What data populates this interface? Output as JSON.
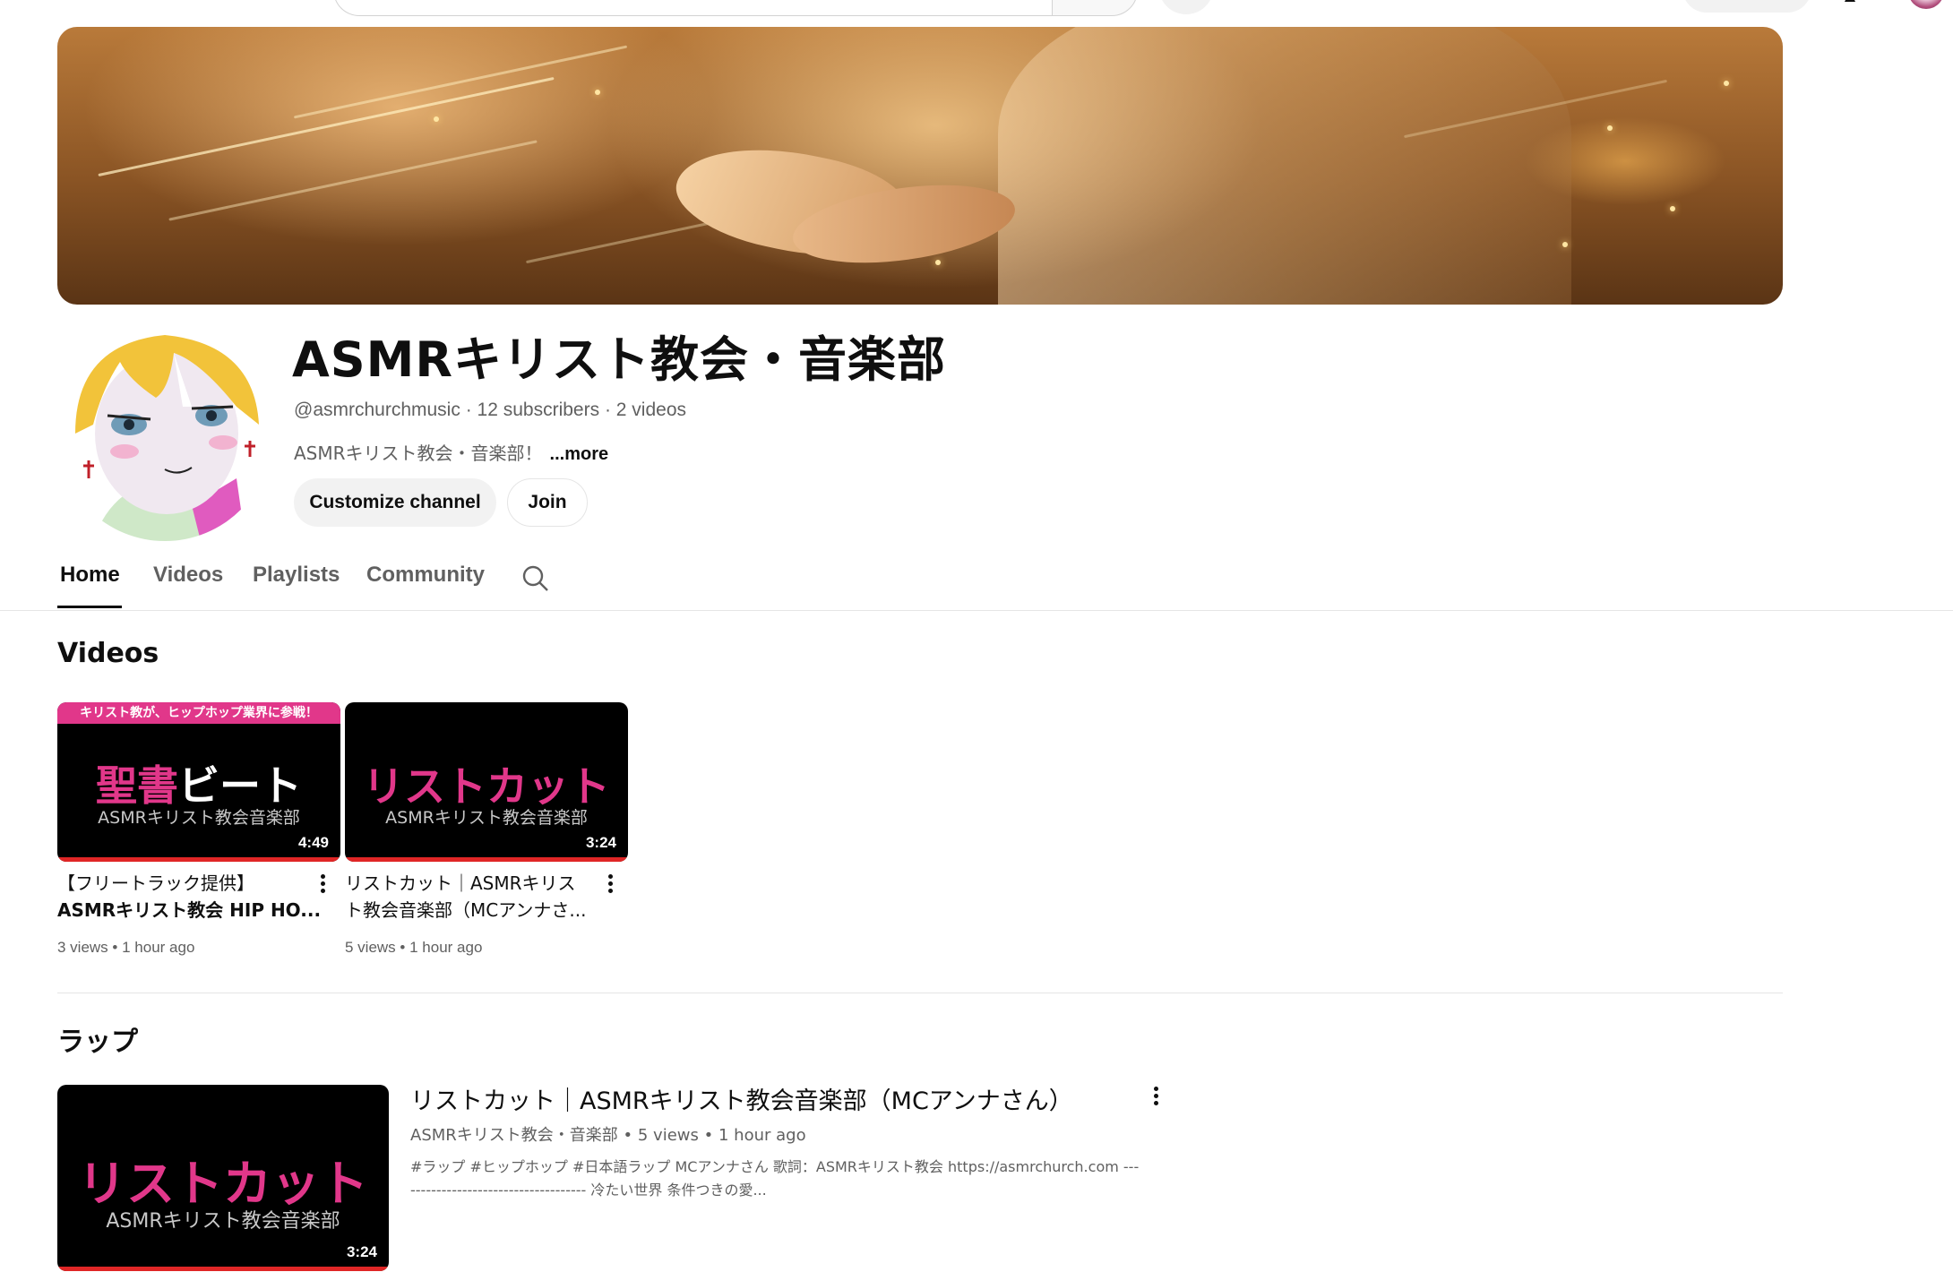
{
  "channel": {
    "name": "ASMRキリスト教会・音楽部",
    "handle": "@asmrchurchmusic",
    "subscribers": "12 subscribers",
    "video_count": "2 videos",
    "description": "ASMRキリスト教会・音楽部！",
    "more_label": "...more",
    "customize_label": "Customize channel",
    "join_label": "Join"
  },
  "tabs": [
    {
      "label": "Home",
      "active": true
    },
    {
      "label": "Videos",
      "active": false
    },
    {
      "label": "Playlists",
      "active": false
    },
    {
      "label": "Community",
      "active": false
    }
  ],
  "sections": {
    "videos": {
      "title": "Videos",
      "items": [
        {
          "thumb_strip": "キリスト教が、ヒップホップ業界に参戦！",
          "thumb_big_pink": "聖書",
          "thumb_big_white": "ビート",
          "thumb_sub": "ASMRキリスト教会音楽部",
          "duration": "4:49",
          "title_line1": "【フリートラック提供】",
          "title_line2": "ASMRキリスト教会 HIP HO...",
          "views": "3 views",
          "age": "1 hour ago"
        },
        {
          "thumb_big_pink": "リストカット",
          "thumb_sub": "ASMRキリスト教会音楽部",
          "duration": "3:24",
          "title_line1": "リストカット｜ASMRキリス",
          "title_line2": "ト教会音楽部（MCアンナさ...",
          "views": "5 views",
          "age": "1 hour ago"
        }
      ]
    },
    "rap": {
      "title": "ラップ",
      "featured": {
        "thumb_big_pink": "リストカット",
        "thumb_sub": "ASMRキリスト教会音楽部",
        "duration": "3:24",
        "title": "リストカット｜ASMRキリスト教会音楽部（MCアンナさん）",
        "channel": "ASMRキリスト教会・音楽部",
        "views": "5 views",
        "age": "1 hour ago",
        "desc_line1": "#ラップ #ヒップホップ #日本語ラップ MCアンナさん 歌詞：ASMRキリスト教会 https://asmrchurch.com ---",
        "desc_line2": "---------------------------------- 冷たい世界 条件つきの愛..."
      }
    }
  },
  "separator": "·",
  "dot": "•",
  "colors": {
    "accent_pink": "#e1378a",
    "progress_red": "#e02626",
    "text_primary": "#0f0f0f",
    "text_secondary": "#606060"
  }
}
